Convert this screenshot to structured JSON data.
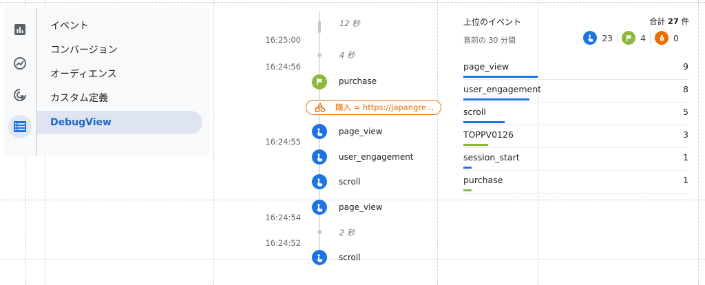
{
  "nav": {
    "items": [
      {
        "label": "イベント",
        "active": false
      },
      {
        "label": "コンバージョン",
        "active": false
      },
      {
        "label": "オーディエンス",
        "active": false
      },
      {
        "label": "カスタム定義",
        "active": false
      },
      {
        "label": "DebugView",
        "active": true
      }
    ],
    "rail_icons": [
      "bar-chart-icon",
      "insights-trend-icon",
      "cursor-click-icon",
      "list-view-icon"
    ]
  },
  "timeline": {
    "times": [
      "16:25:00",
      "16:24:56",
      "16:24:55",
      "16:24:54",
      "16:24:52"
    ],
    "gaps": [
      "12 秒",
      "4 秒",
      "2 秒"
    ],
    "events": [
      {
        "name": "purchase",
        "type": "conversion"
      },
      {
        "name": "page_view",
        "type": "event"
      },
      {
        "name": "user_engagement",
        "type": "event"
      },
      {
        "name": "scroll",
        "type": "event"
      },
      {
        "name": "page_view",
        "type": "event"
      },
      {
        "name": "scroll",
        "type": "event"
      }
    ],
    "conversion_param": "購入 = https://japangreet…"
  },
  "summary": {
    "title": "上位のイベント",
    "total_prefix": "合計",
    "total_value": "27",
    "total_suffix": "件",
    "subtitle": "直前の 30 分間",
    "counts": {
      "events": "23",
      "conversions": "4",
      "errors": "0"
    },
    "rows": [
      {
        "name": "page_view",
        "value": "9",
        "share": 0.36,
        "color": "#1a73e8"
      },
      {
        "name": "user_engagement",
        "value": "8",
        "share": 0.32,
        "color": "#1a73e8"
      },
      {
        "name": "scroll",
        "value": "5",
        "share": 0.2,
        "color": "#1a73e8"
      },
      {
        "name": "TOPPV0126",
        "value": "3",
        "share": 0.12,
        "color": "#8bb93a"
      },
      {
        "name": "session_start",
        "value": "1",
        "share": 0.04,
        "color": "#1a73e8"
      },
      {
        "name": "purchase",
        "value": "1",
        "share": 0.04,
        "color": "#8bb93a"
      }
    ]
  },
  "colors": {
    "accent_blue": "#1a73e8",
    "conversion_green": "#8bb93a",
    "error_orange": "#ef6c00",
    "nav_active_text": "#1967d2"
  }
}
